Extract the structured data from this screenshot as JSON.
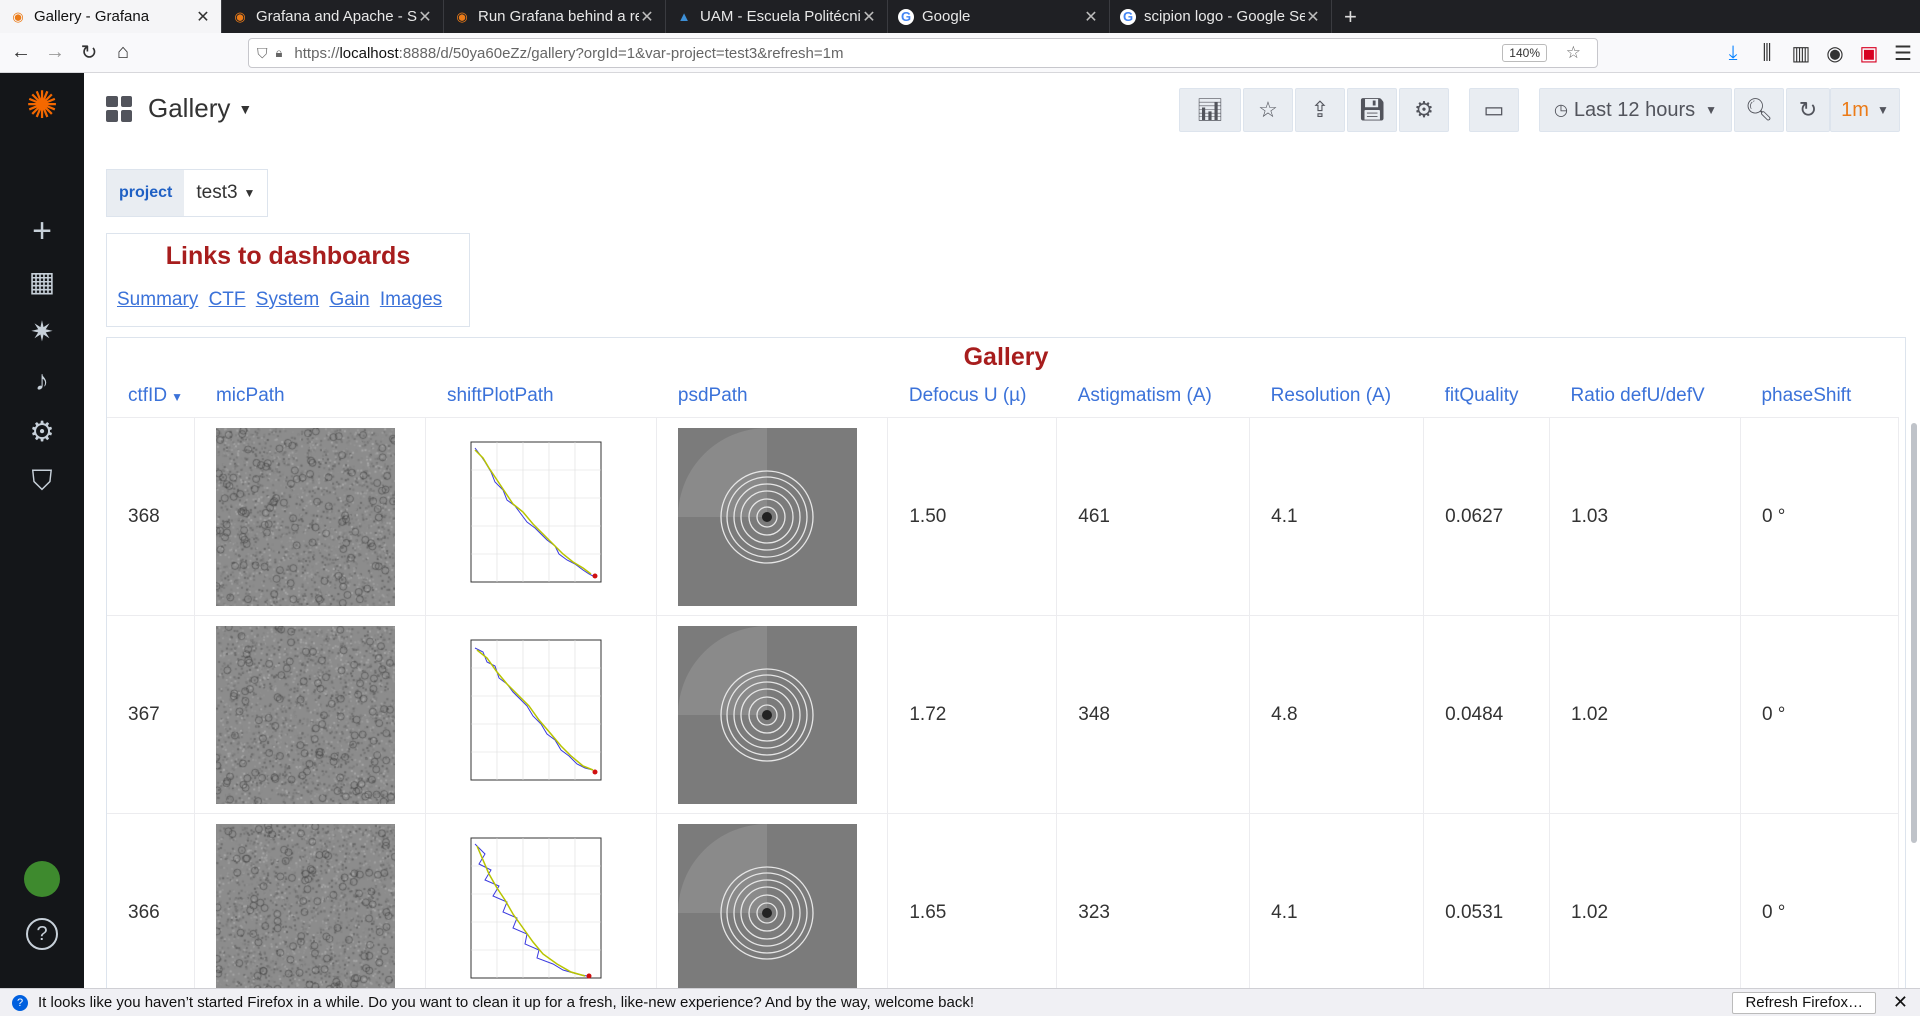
{
  "browser": {
    "tabs": [
      {
        "title": "Gallery - Grafana",
        "active": true,
        "icon": "grafana-icon"
      },
      {
        "title": "Grafana and Apache - Su",
        "active": false,
        "icon": "grafana-icon"
      },
      {
        "title": "Run Grafana behind a re",
        "active": false,
        "icon": "grafana-icon"
      },
      {
        "title": "UAM - Escuela Politécnic",
        "active": false,
        "icon": "uam-icon"
      },
      {
        "title": "Google",
        "active": false,
        "icon": "google-icon"
      },
      {
        "title": "scipion logo - Google Se",
        "active": false,
        "icon": "google-icon"
      }
    ],
    "url_prefix": "https://",
    "url_host": "localhost",
    "url_rest": ":8888/d/50ya60eZz/gallery?orgId=1&var-project=test3&refresh=1m",
    "zoom": "140%"
  },
  "dashboard": {
    "title": "Gallery",
    "time_range": "Last 12 hours",
    "refresh": "1m"
  },
  "variable": {
    "label": "project",
    "value": "test3"
  },
  "links_panel": {
    "title": "Links to dashboards",
    "links": [
      "Summary",
      "CTF",
      "System",
      "Gain",
      "Images"
    ]
  },
  "gallery": {
    "title": "Gallery",
    "columns": [
      "ctfID",
      "micPath",
      "shiftPlotPath",
      "psdPath",
      "Defocus U (µ)",
      "Astigmatism (A)",
      "Resolution (A)",
      "fitQuality",
      "Ratio defU/defV",
      "phaseShift"
    ],
    "rows": [
      {
        "ctfID": "368",
        "defocus": "1.50",
        "astig": "461",
        "resolution": "4.1",
        "fit": "0.0627",
        "ratio": "1.03",
        "phase": "0 °"
      },
      {
        "ctfID": "367",
        "defocus": "1.72",
        "astig": "348",
        "resolution": "4.8",
        "fit": "0.0484",
        "ratio": "1.02",
        "phase": "0 °"
      },
      {
        "ctfID": "366",
        "defocus": "1.65",
        "astig": "323",
        "resolution": "4.1",
        "fit": "0.0531",
        "ratio": "1.02",
        "phase": "0 °"
      }
    ]
  },
  "notification": {
    "text": "It looks like you haven’t started Firefox in a while. Do you want to clean it up for a fresh, like-new experience? And by the way, welcome back!",
    "button": "Refresh Firefox…"
  },
  "colors": {
    "panel_title": "#a71d1d",
    "link": "#3b72d9",
    "sidemenu": "#141619",
    "accent_orange": "#eb7b18"
  }
}
